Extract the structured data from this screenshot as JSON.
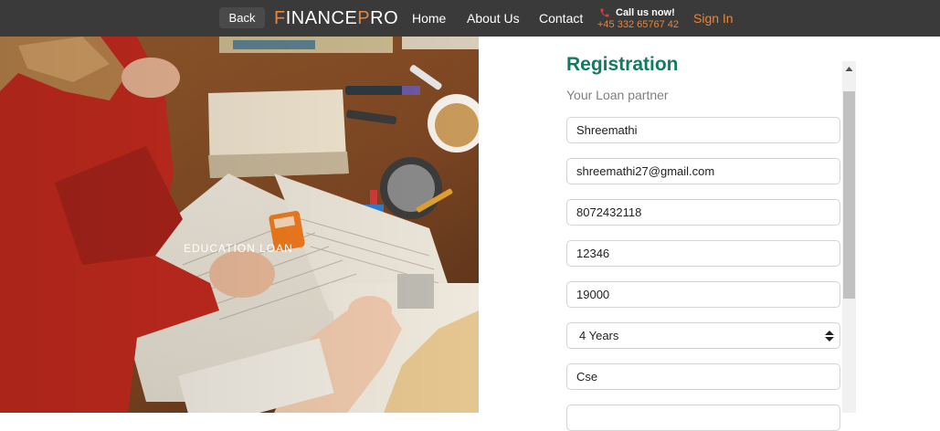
{
  "navbar": {
    "back_label": "Back",
    "brand_first_letter": "F",
    "brand_middle": "INANCE",
    "brand_p": "P",
    "brand_last": "RO",
    "links": [
      "Home",
      "About Us",
      "Contact"
    ],
    "call_label": "Call us now!",
    "call_phone": "+45 332 65767 42",
    "signin_label": "Sign In",
    "accent_color": "#e8853d",
    "background_color": "#3a3a3a"
  },
  "hero": {
    "caption": "EDUCATION LOAN"
  },
  "registration": {
    "title": "Registration",
    "subtitle": "Your Loan partner",
    "title_color": "#137a62",
    "fields": {
      "name": "Shreemathi",
      "email": "shreemathi27@gmail.com",
      "phone": "8072432118",
      "field_4": "12346",
      "amount": "19000",
      "duration": "4 Years",
      "course": "Cse"
    }
  },
  "icons": {
    "phone": "phone-icon",
    "select_arrow": "select-arrow-icon",
    "scroll_up": "scroll-up-arrow-icon"
  }
}
